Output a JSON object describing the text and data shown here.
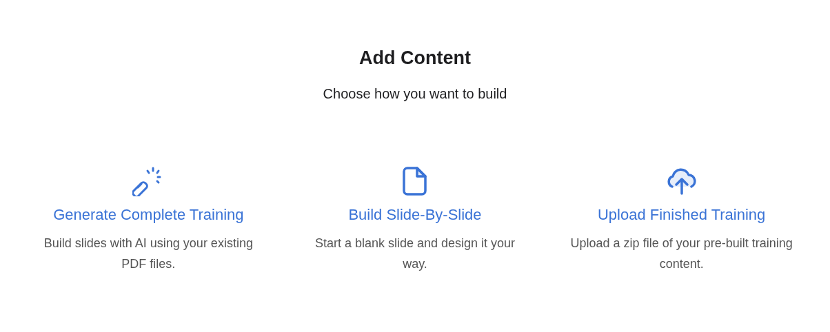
{
  "title": "Add Content",
  "subtitle": "Choose how you want to build",
  "options": [
    {
      "kind": "generate",
      "title": "Generate Complete Training",
      "description": "Build slides with AI using your existing PDF files."
    },
    {
      "kind": "build",
      "title": "Build Slide-By-Slide",
      "description": "Start a blank slide and design it your way."
    },
    {
      "kind": "upload",
      "title": "Upload Finished Training",
      "description": "Upload a zip file of your pre-built training content."
    }
  ]
}
